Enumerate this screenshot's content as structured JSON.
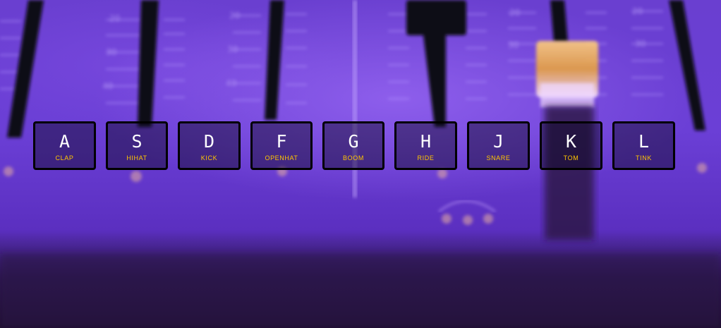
{
  "background": {
    "description_colors": {
      "primary": "#6b3fd6",
      "dark": "#241335",
      "accent": "#ffc600"
    }
  },
  "keys": [
    {
      "letter": "A",
      "sound": "CLAP"
    },
    {
      "letter": "S",
      "sound": "HIHAT"
    },
    {
      "letter": "D",
      "sound": "KICK"
    },
    {
      "letter": "F",
      "sound": "OPENHAT"
    },
    {
      "letter": "G",
      "sound": "BOOM"
    },
    {
      "letter": "H",
      "sound": "RIDE"
    },
    {
      "letter": "J",
      "sound": "SNARE"
    },
    {
      "letter": "K",
      "sound": "TOM"
    },
    {
      "letter": "L",
      "sound": "TINK"
    }
  ],
  "mixer_scale_labels": [
    "20",
    "30",
    "40",
    "20",
    "30",
    "40",
    "20",
    "30",
    "20",
    "30"
  ]
}
